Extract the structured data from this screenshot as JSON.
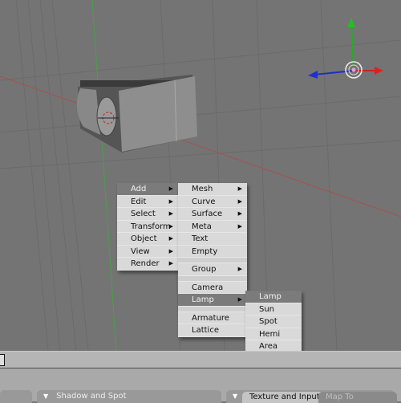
{
  "viewport": {
    "colors": {
      "background": "#747474",
      "x_axis": "#c04040",
      "y_axis": "#40a040",
      "grid": "#6a6a6a"
    },
    "gizmo": {
      "x_color": "#e02020",
      "y_color": "#20c020",
      "z_color": "#2030d0"
    }
  },
  "add_menu": {
    "items": [
      {
        "label": "Add",
        "submenu": true,
        "active": true
      },
      {
        "label": "Edit",
        "submenu": true
      },
      {
        "label": "Select",
        "submenu": true
      },
      {
        "label": "Transform",
        "submenu": true
      },
      {
        "label": "Object",
        "submenu": true
      },
      {
        "label": "View",
        "submenu": true
      },
      {
        "label": "Render",
        "submenu": true
      }
    ]
  },
  "add_submenu": {
    "items": [
      {
        "label": "Mesh",
        "submenu": true
      },
      {
        "label": "Curve",
        "submenu": true
      },
      {
        "label": "Surface",
        "submenu": true
      },
      {
        "label": "Meta",
        "submenu": true
      },
      {
        "label": "Text"
      },
      {
        "label": "Empty"
      },
      {
        "label": "Group",
        "submenu": true
      },
      {
        "label": "Camera"
      },
      {
        "label": "Lamp",
        "submenu": true,
        "active": true
      },
      {
        "label": "Armature"
      },
      {
        "label": "Lattice"
      }
    ]
  },
  "lamp_submenu": {
    "items": [
      {
        "label": "Lamp",
        "active": true
      },
      {
        "label": "Sun"
      },
      {
        "label": "Spot"
      },
      {
        "label": "Hemi"
      },
      {
        "label": "Area"
      }
    ]
  },
  "buttons_window": {
    "panels": [
      {
        "label": "Shadow and Spot",
        "collapse_icon": "▼"
      },
      {
        "collapse_icon": "▼",
        "tabs": [
          {
            "label": "Texture and Input",
            "active": true
          },
          {
            "label": "Map To",
            "active": false
          }
        ]
      }
    ]
  },
  "icons": {
    "submenu_arrow": "▶",
    "collapse": "▼"
  }
}
